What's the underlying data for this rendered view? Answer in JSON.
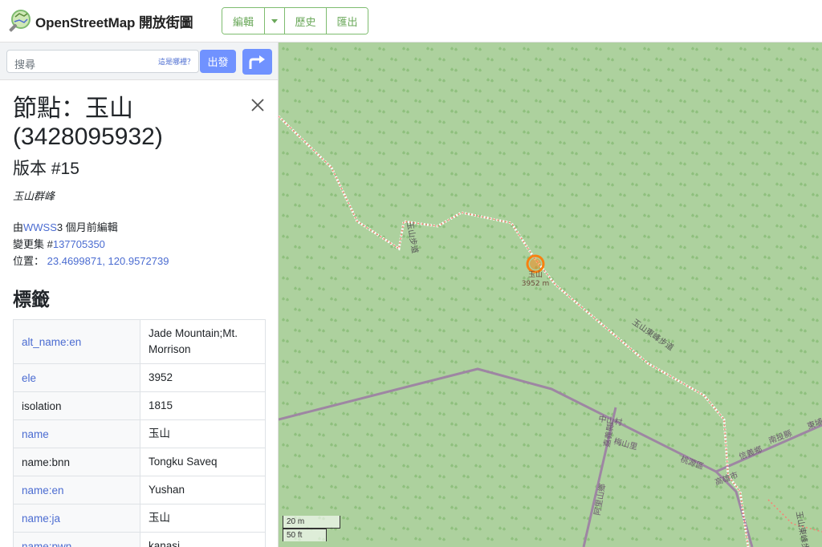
{
  "header": {
    "brand": "OpenStreetMap 開放街圖",
    "edit_label": "編輯",
    "history_label": "歷史",
    "export_label": "匯出"
  },
  "search": {
    "placeholder": "搜尋",
    "where_label": "這是哪裡？",
    "go_label": "出發"
  },
  "feature": {
    "title": "節點：玉山 (3428095932)",
    "version": "版本 #15",
    "description": "玉山群峰",
    "edited_prefix": "由",
    "editor": "WWSS",
    "edited_suffix": "3 個月前編輯",
    "changeset_prefix": "變更集 #",
    "changeset": "137705350",
    "location_prefix": "位置：",
    "location": "23.4699871, 120.9572739"
  },
  "tags_heading": "標籤",
  "tags": [
    {
      "key": "alt_name:en",
      "value": "Jade Mountain;Mt. Morrison",
      "link": true
    },
    {
      "key": "ele",
      "value": "3952",
      "link": true
    },
    {
      "key": "isolation",
      "value": "1815",
      "link": false
    },
    {
      "key": "name",
      "value": "玉山",
      "link": true
    },
    {
      "key": "name:bnn",
      "value": "Tongku Saveq",
      "link": false
    },
    {
      "key": "name:en",
      "value": "Yushan",
      "link": true
    },
    {
      "key": "name:ja",
      "value": "玉山",
      "link": true
    },
    {
      "key": "name:pwn",
      "value": "kanasi",
      "link": true
    }
  ],
  "map": {
    "peak_name": "玉山",
    "peak_elevation": "3952 m",
    "labels": {
      "trail_west": "玉山步道",
      "trail_east": "玉山東峰步道",
      "zhongshan": "中山村",
      "meishan": "梅山里",
      "taoyuan": "桃源區",
      "kaohsiung": "高雄市",
      "xinyi": "信義鄉",
      "nantou": "南投縣",
      "east_trail_2": "玉山東峰步道",
      "dongpu": "東埔",
      "jiayi": "嘉義縣",
      "alishan": "阿里山鄉"
    },
    "scale_m": "20 m",
    "scale_ft": "50 ft"
  },
  "colors": {
    "forest": "#add19e",
    "trail": "#fa8072",
    "boundary": "#9e86a3",
    "accent": "#7092ff",
    "brand_green": "#7ebc6f",
    "peak_marker": "#ff7800"
  }
}
